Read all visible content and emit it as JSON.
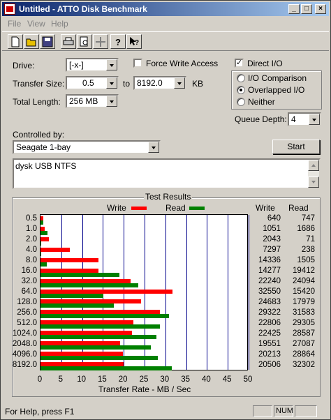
{
  "window": {
    "title": "Untitled - ATTO Disk Benchmark"
  },
  "menu": [
    "File",
    "View",
    "Help"
  ],
  "settings": {
    "drive_label": "Drive:",
    "drive_value": "[-x-]",
    "force_write_label": "Force Write Access",
    "force_write_checked": false,
    "direct_io_label": "Direct I/O",
    "direct_io_checked": true,
    "transfer_size_label": "Transfer Size:",
    "transfer_from": "0.5",
    "to_label": "to",
    "transfer_to": "8192.0",
    "kb_label": "KB",
    "total_length_label": "Total Length:",
    "total_length_value": "256 MB",
    "io_modes": [
      {
        "label": "I/O Comparison",
        "selected": false
      },
      {
        "label": "Overlapped I/O",
        "selected": true
      },
      {
        "label": "Neither",
        "selected": false
      }
    ],
    "queue_depth_label": "Queue Depth:",
    "queue_depth_value": "4",
    "controlled_by_label": "Controlled by:",
    "controlled_by_value": "Seagate 1-bay",
    "start_label": "Start",
    "notes": "dysk USB NTFS"
  },
  "results": {
    "title": "Test Results",
    "write_legend": "Write",
    "read_legend": "Read",
    "write_col": "Write",
    "read_col": "Read",
    "xlabel": "Transfer Rate - MB / Sec",
    "colors": {
      "write": "#ff0000",
      "read": "#008000"
    }
  },
  "chart_data": {
    "type": "bar",
    "orientation": "horizontal",
    "title": "Test Results",
    "xlabel": "Transfer Rate - MB / Sec",
    "xlim": [
      0,
      50
    ],
    "xticks": [
      "0",
      "5",
      "10",
      "15",
      "20",
      "25",
      "30",
      "35",
      "40",
      "45",
      "50"
    ],
    "categories": [
      "0.5",
      "1.0",
      "2.0",
      "4.0",
      "8.0",
      "16.0",
      "32.0",
      "64.0",
      "128.0",
      "256.0",
      "512.0",
      "1024.0",
      "2048.0",
      "4096.0",
      "8192.0"
    ],
    "series": [
      {
        "name": "Write",
        "values": [
          640,
          1051,
          2043,
          7297,
          14336,
          14277,
          22240,
          32550,
          24683,
          29322,
          22806,
          22425,
          19551,
          20213,
          20506
        ]
      },
      {
        "name": "Read",
        "values": [
          747,
          1686,
          71,
          238,
          1505,
          19412,
          24094,
          15420,
          17979,
          31583,
          29305,
          28587,
          27087,
          28864,
          32302
        ]
      }
    ],
    "grid": true,
    "legend": "top"
  },
  "status": {
    "help_text": "For Help, press F1",
    "num": "NUM"
  }
}
